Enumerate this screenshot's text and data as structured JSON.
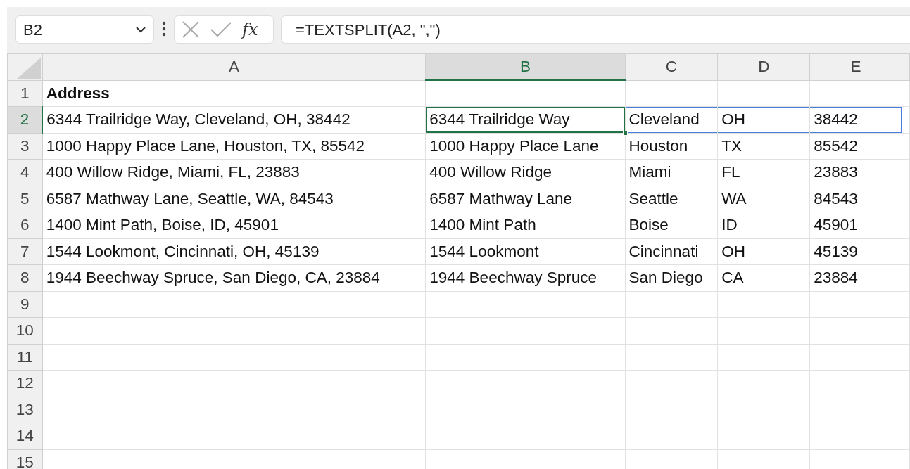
{
  "formula_bar": {
    "name_box": "B2",
    "function_label": "fx",
    "formula": "=TEXTSPLIT(A2, \",\")"
  },
  "columns": [
    {
      "label": "A",
      "selected": false
    },
    {
      "label": "B",
      "selected": true
    },
    {
      "label": "C",
      "selected": false
    },
    {
      "label": "D",
      "selected": false
    },
    {
      "label": "E",
      "selected": false
    }
  ],
  "rows": [
    {
      "number": "1",
      "selected": false,
      "bold": true,
      "cells": [
        "Address"
      ]
    },
    {
      "number": "2",
      "selected": true,
      "cells": [
        "6344 Trailridge Way, Cleveland, OH, 38442",
        "6344 Trailridge Way",
        "Cleveland",
        "OH",
        "38442"
      ]
    },
    {
      "number": "3",
      "selected": false,
      "cells": [
        "1000 Happy Place Lane, Houston, TX, 85542",
        "1000 Happy Place Lane",
        "Houston",
        "TX",
        "85542"
      ]
    },
    {
      "number": "4",
      "selected": false,
      "cells": [
        "400 Willow Ridge, Miami, FL, 23883",
        "400 Willow Ridge",
        "Miami",
        "FL",
        "23883"
      ]
    },
    {
      "number": "5",
      "selected": false,
      "cells": [
        "6587 Mathway Lane, Seattle, WA, 84543",
        "6587 Mathway Lane",
        "Seattle",
        "WA",
        "84543"
      ]
    },
    {
      "number": "6",
      "selected": false,
      "cells": [
        "1400 Mint Path, Boise, ID, 45901",
        "1400 Mint Path",
        "Boise",
        "ID",
        "45901"
      ]
    },
    {
      "number": "7",
      "selected": false,
      "cells": [
        "1544 Lookmont, Cincinnati, OH, 45139",
        "1544 Lookmont",
        "Cincinnati",
        "OH",
        "45139"
      ]
    },
    {
      "number": "8",
      "selected": false,
      "cells": [
        "1944 Beechway Spruce, San Diego, CA, 23884",
        "1944 Beechway Spruce",
        "San Diego",
        "CA",
        "23884"
      ]
    },
    {
      "number": "9",
      "selected": false
    },
    {
      "number": "10",
      "selected": false
    },
    {
      "number": "11",
      "selected": false
    },
    {
      "number": "12",
      "selected": false
    },
    {
      "number": "13",
      "selected": false
    },
    {
      "number": "14",
      "selected": false
    },
    {
      "number": "15",
      "selected": false
    }
  ]
}
